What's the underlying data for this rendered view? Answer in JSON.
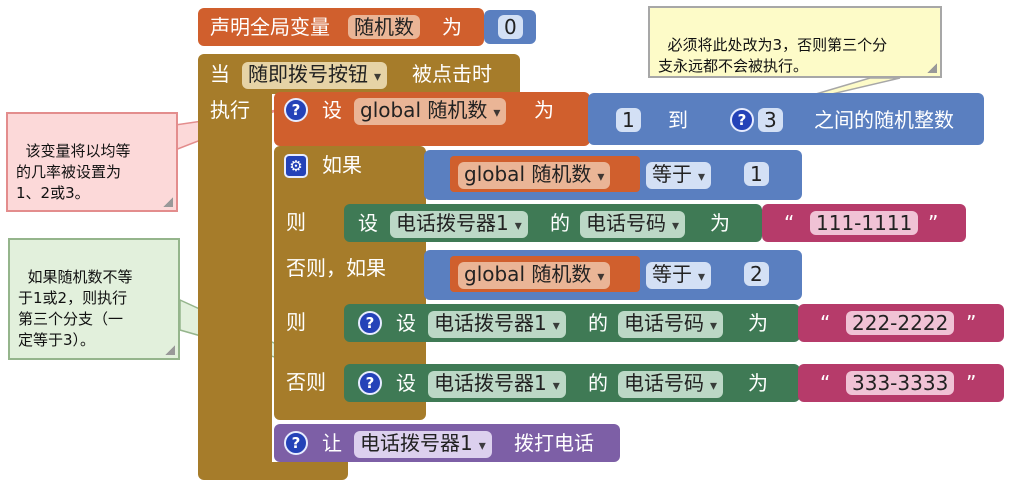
{
  "declare": {
    "label": "声明全局变量",
    "var_name": "随机数",
    "word_as": "为",
    "init_value": "0"
  },
  "event": {
    "when": "当",
    "component": "随即拨号按钮",
    "event_name": "被点击时",
    "do": "执行"
  },
  "set_var": {
    "set": "设",
    "var": "global 随机数",
    "as": "为"
  },
  "random": {
    "from_value": "1",
    "to": "到",
    "to_value": "3",
    "suffix": "之间的随机整数"
  },
  "if_block": {
    "if": "如果",
    "then": "则",
    "elseif": "否则，如果",
    "else": "否则",
    "cond1": {
      "var": "global 随机数",
      "op": "等于",
      "value": "1"
    },
    "cond2": {
      "var": "global 随机数",
      "op": "等于",
      "value": "2"
    }
  },
  "set_phone": [
    {
      "set": "设",
      "component": "电话拨号器1",
      "of": "的",
      "prop": "电话号码",
      "as": "为",
      "value": "111-1111"
    },
    {
      "set": "设",
      "component": "电话拨号器1",
      "of": "的",
      "prop": "电话号码",
      "as": "为",
      "value": "222-2222"
    },
    {
      "set": "设",
      "component": "电话拨号器1",
      "of": "的",
      "prop": "电话号码",
      "as": "为",
      "value": "333-3333"
    }
  ],
  "call": {
    "let": "让",
    "component": "电话拨号器1",
    "method": "拨打电话"
  },
  "quote_open": "“",
  "quote_close": "”",
  "notes": {
    "top": "必须将此处改为3，否则第三个分\n支永远都不会被执行。",
    "left1": "该变量将以均等\n的几率被设置为\n1、2或3。",
    "left2": "如果随机数不等\n于1或2，则执行\n第三个分支（一\n定等于3）。"
  },
  "colors": {
    "variables": "#d05f2d",
    "control": "#a67c2a",
    "math": "#5a7fc0",
    "component": "#3f7a55",
    "text": "#b63b6a",
    "method": "#7d5fa6",
    "note_yellow": "#fdfbc8",
    "note_pink": "#fcd9d9",
    "note_green": "#e2f0dc"
  }
}
